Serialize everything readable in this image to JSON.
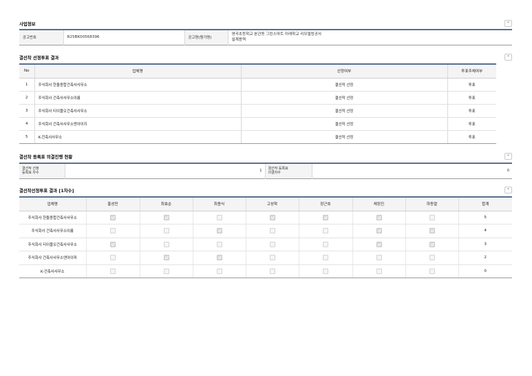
{
  "sections": {
    "info": {
      "title": "사업정보",
      "notice_no_label": "공고번호",
      "notice_no": "R25BK00568396",
      "notice_name_label": "공고명(평가명)",
      "notice_name_line1": "영곡초등학교 본관동 그린스마트 미래학교 리모델링공사",
      "notice_name_line2": "설계용역"
    },
    "result": {
      "title": "결선작 선정투표 결과",
      "headers": {
        "no": "No",
        "firm": "업체명",
        "selected": "선정여부",
        "vote": "투표주체여부"
      },
      "rows": [
        {
          "no": "1",
          "firm": "주식회사 한돌종합건축사사무소",
          "selected": "결선작 선정",
          "vote": "투표"
        },
        {
          "no": "2",
          "firm": "주식회사 건축사사무소이름",
          "selected": "결선작 선정",
          "vote": "투표"
        },
        {
          "no": "3",
          "firm": "주식회사 티이블오건축사사무소",
          "selected": "결선작 선정",
          "vote": "투표"
        },
        {
          "no": "4",
          "firm": "주식회사 건축사사무소엔아이지",
          "selected": "결선작 선정",
          "vote": "투표"
        },
        {
          "no": "5",
          "firm": "K-건축사사무소",
          "selected": "결선작 선정",
          "vote": "투표"
        }
      ]
    },
    "progress": {
      "title": "결선작 등록표 의결진행 현황",
      "round_label_1": "결선작 선정",
      "round_label_2": "등록표 차수",
      "round_value": "1",
      "count_label_1": "결선작 등록표",
      "count_label_2": "의결차수",
      "count_value": "0"
    },
    "votes": {
      "title": "결선작선정투표 결과 [1차수]",
      "headers": [
        "업체명",
        "홍성민",
        "최효순",
        "최용식",
        "고성학",
        "장근호",
        "채정진",
        "하동열",
        "합계"
      ],
      "rows": [
        {
          "firm": "주식회사 한돌종합건축사사무소",
          "checks": [
            true,
            true,
            false,
            true,
            true,
            true,
            false
          ],
          "total": "5"
        },
        {
          "firm": "주식회사 건축사사무소이름",
          "checks": [
            false,
            false,
            true,
            false,
            false,
            true,
            true
          ],
          "total": "4"
        },
        {
          "firm": "주식회사 티이블오건축사사무소",
          "checks": [
            true,
            false,
            false,
            false,
            false,
            true,
            true
          ],
          "total": "3"
        },
        {
          "firm": "주식회사 건축사사무소엔아이피",
          "checks": [
            false,
            true,
            true,
            false,
            false,
            false,
            false
          ],
          "total": "2"
        },
        {
          "firm": "K-건축사사무소",
          "checks": [
            false,
            false,
            false,
            false,
            false,
            false,
            false
          ],
          "total": "0"
        }
      ]
    }
  },
  "icons": {
    "collapse": "chevron-up-icon",
    "checkbox": "checkbox-icon"
  },
  "colors": {
    "header_rule": "#5a6f8e",
    "label_bg": "#f4f4f4"
  }
}
